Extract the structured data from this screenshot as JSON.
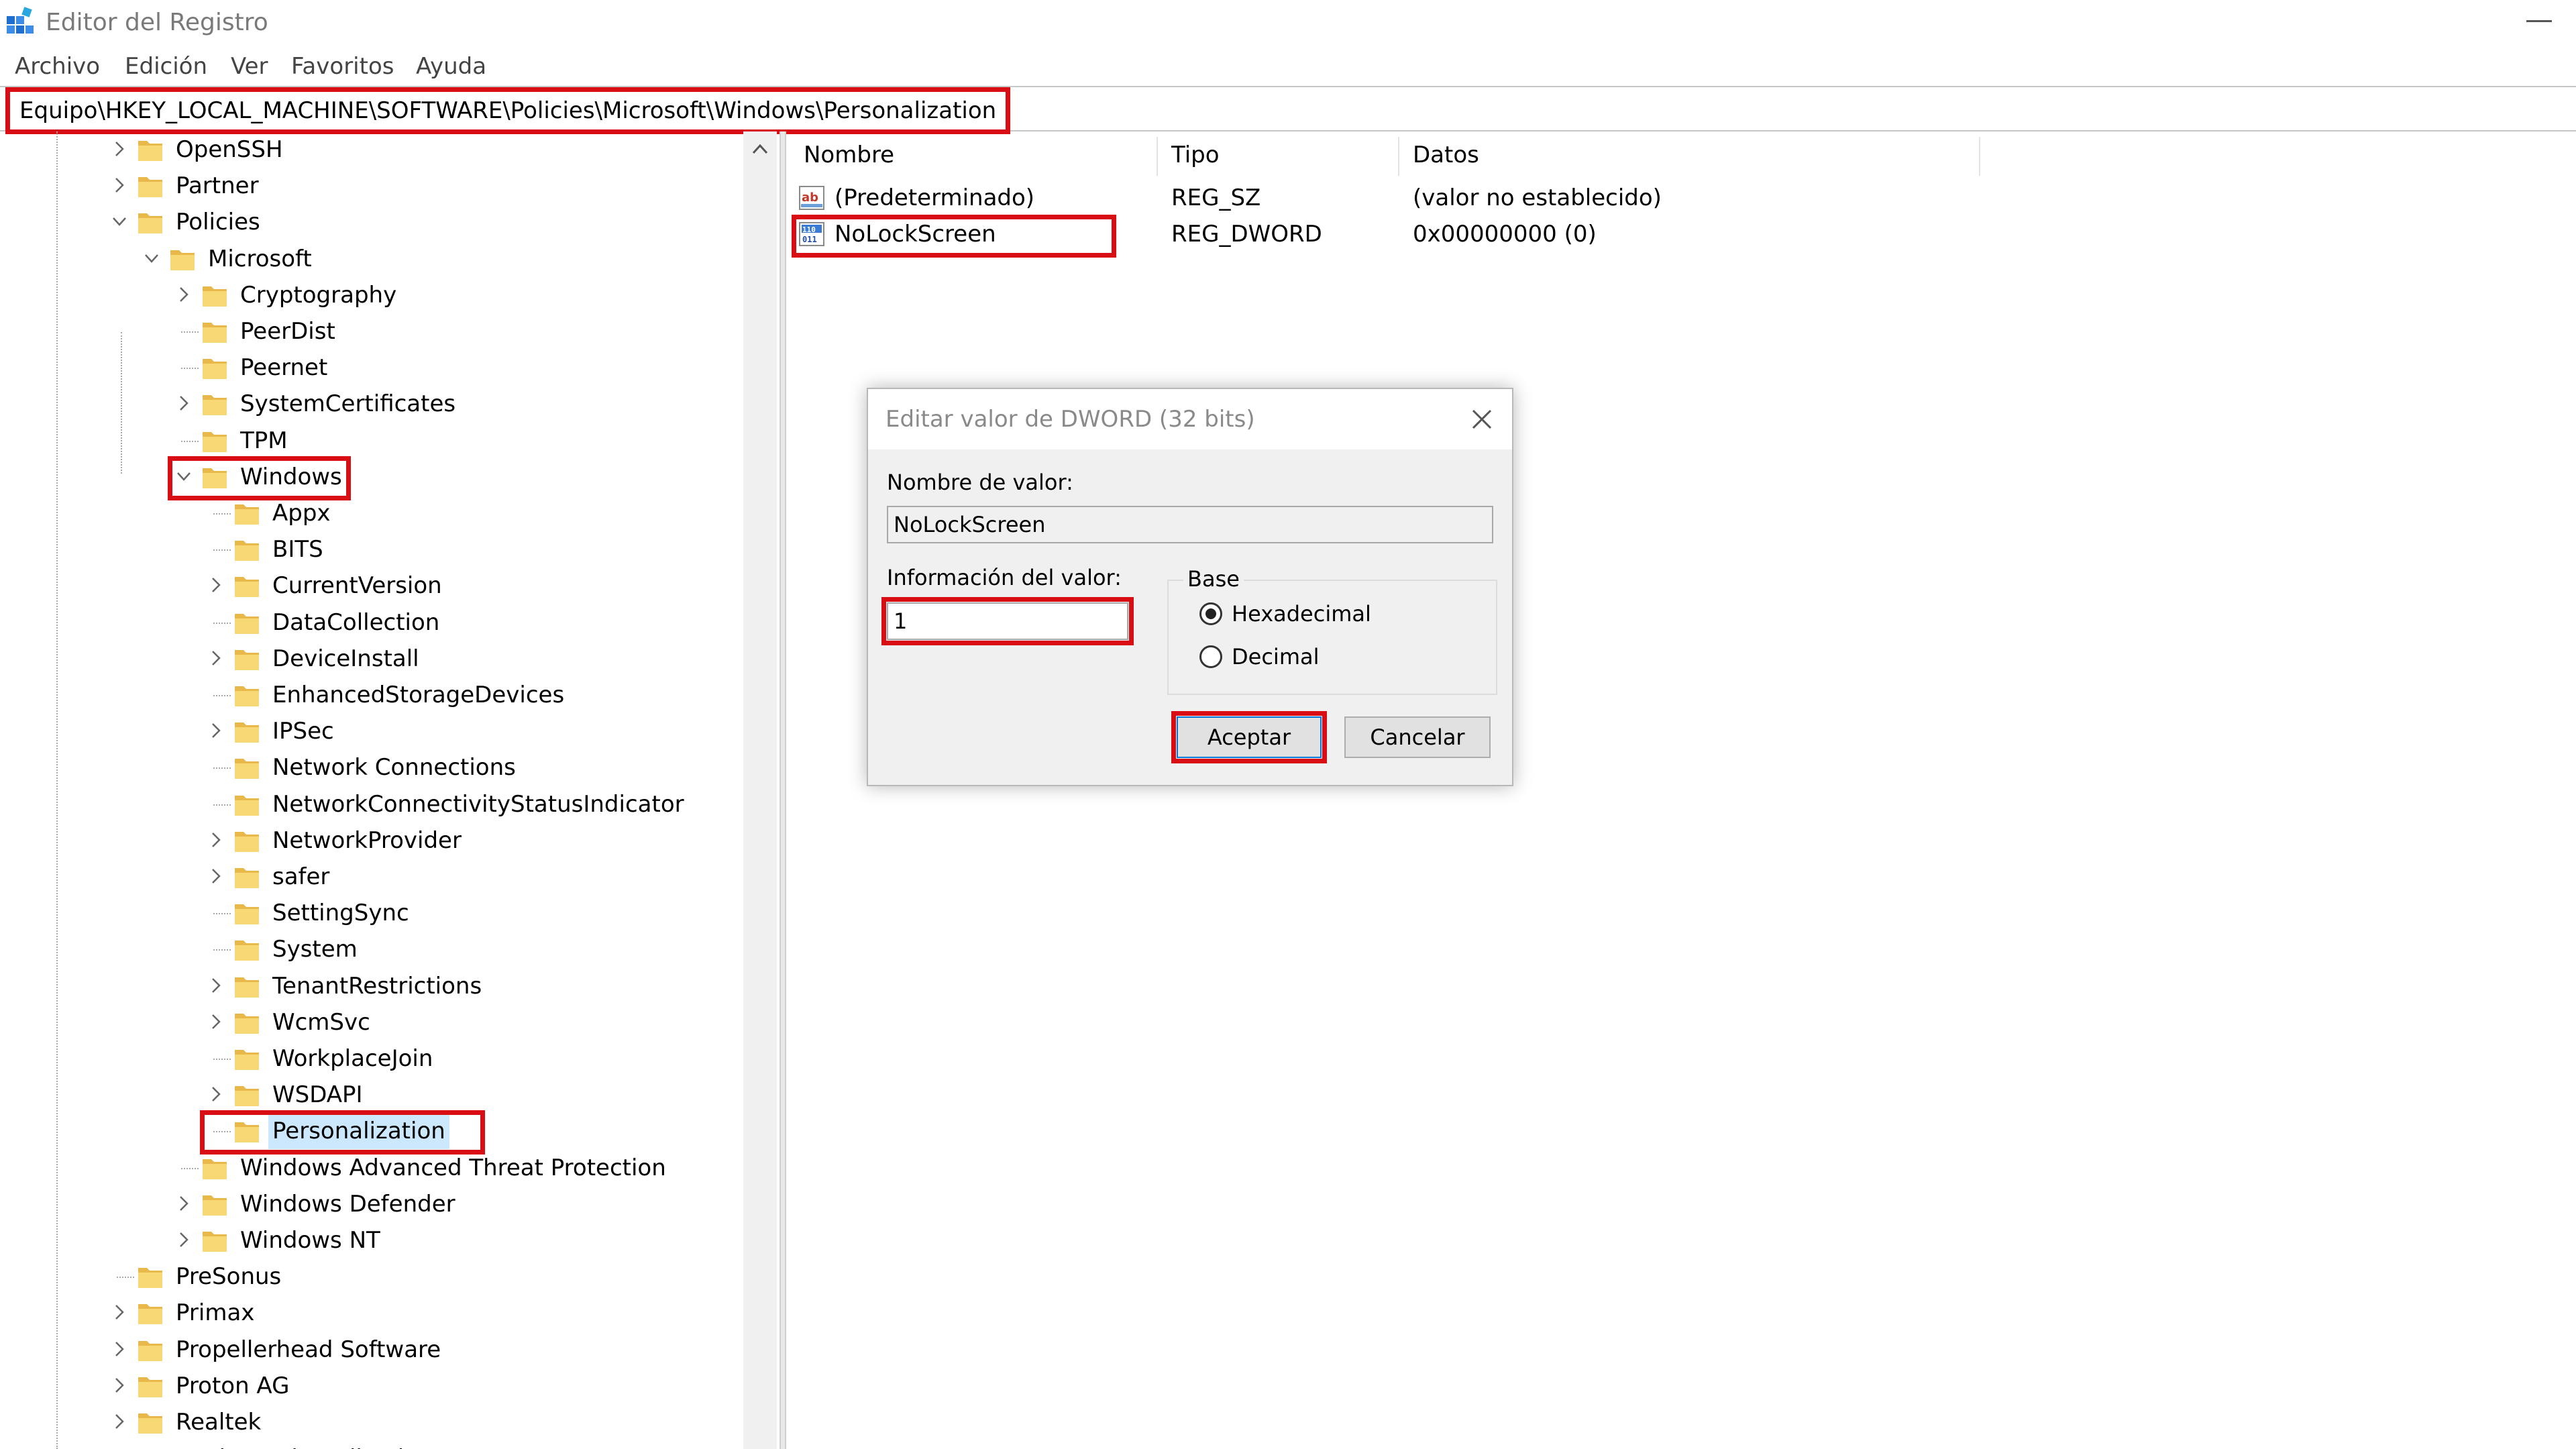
{
  "window": {
    "title": "Editor del Registro"
  },
  "menu": [
    "Archivo",
    "Edición",
    "Ver",
    "Favoritos",
    "Ayuda"
  ],
  "address": "Equipo\\HKEY_LOCAL_MACHINE\\SOFTWARE\\Policies\\Microsoft\\Windows\\Personalization",
  "tree": [
    {
      "label": "OpenSSH",
      "level": 0,
      "chevron": "right"
    },
    {
      "label": "Partner",
      "level": 0,
      "chevron": "right"
    },
    {
      "label": "Policies",
      "level": 0,
      "chevron": "down"
    },
    {
      "label": "Microsoft",
      "level": 1,
      "chevron": "down"
    },
    {
      "label": "Cryptography",
      "level": 2,
      "chevron": "right"
    },
    {
      "label": "PeerDist",
      "level": 2,
      "chevron": "none"
    },
    {
      "label": "Peernet",
      "level": 2,
      "chevron": "none"
    },
    {
      "label": "SystemCertificates",
      "level": 2,
      "chevron": "right"
    },
    {
      "label": "TPM",
      "level": 2,
      "chevron": "none"
    },
    {
      "label": "Windows",
      "level": 2,
      "chevron": "down",
      "highlight": true
    },
    {
      "label": "Appx",
      "level": 3,
      "chevron": "none"
    },
    {
      "label": "BITS",
      "level": 3,
      "chevron": "none"
    },
    {
      "label": "CurrentVersion",
      "level": 3,
      "chevron": "right"
    },
    {
      "label": "DataCollection",
      "level": 3,
      "chevron": "none"
    },
    {
      "label": "DeviceInstall",
      "level": 3,
      "chevron": "right"
    },
    {
      "label": "EnhancedStorageDevices",
      "level": 3,
      "chevron": "none"
    },
    {
      "label": "IPSec",
      "level": 3,
      "chevron": "right"
    },
    {
      "label": "Network Connections",
      "level": 3,
      "chevron": "none"
    },
    {
      "label": "NetworkConnectivityStatusIndicator",
      "level": 3,
      "chevron": "none"
    },
    {
      "label": "NetworkProvider",
      "level": 3,
      "chevron": "right"
    },
    {
      "label": "safer",
      "level": 3,
      "chevron": "right"
    },
    {
      "label": "SettingSync",
      "level": 3,
      "chevron": "none"
    },
    {
      "label": "System",
      "level": 3,
      "chevron": "none"
    },
    {
      "label": "TenantRestrictions",
      "level": 3,
      "chevron": "right"
    },
    {
      "label": "WcmSvc",
      "level": 3,
      "chevron": "right"
    },
    {
      "label": "WorkplaceJoin",
      "level": 3,
      "chevron": "none"
    },
    {
      "label": "WSDAPI",
      "level": 3,
      "chevron": "right"
    },
    {
      "label": "Personalization",
      "level": 3,
      "chevron": "none",
      "highlight": true,
      "selected": true
    },
    {
      "label": "Windows Advanced Threat Protection",
      "level": 2,
      "chevron": "none"
    },
    {
      "label": "Windows Defender",
      "level": 2,
      "chevron": "right"
    },
    {
      "label": "Windows NT",
      "level": 2,
      "chevron": "right"
    },
    {
      "label": "PreSonus",
      "level": 0,
      "chevron": "none"
    },
    {
      "label": "Primax",
      "level": 0,
      "chevron": "right"
    },
    {
      "label": "Propellerhead Software",
      "level": 0,
      "chevron": "right"
    },
    {
      "label": "Proton AG",
      "level": 0,
      "chevron": "right"
    },
    {
      "label": "Realtek",
      "level": 0,
      "chevron": "right"
    },
    {
      "label": "Registered Applications",
      "level": 0,
      "chevron": "none"
    }
  ],
  "list": {
    "columns": [
      "Nombre",
      "Tipo",
      "Datos"
    ],
    "rows": [
      {
        "name": "(Predeterminado)",
        "type": "REG_SZ",
        "data": "(valor no establecido)",
        "icon": "string-value-icon"
      },
      {
        "name": "NoLockScreen",
        "type": "REG_DWORD",
        "data": "0x00000000 (0)",
        "icon": "dword-value-icon",
        "highlight": true
      }
    ]
  },
  "dialog": {
    "title": "Editar valor de DWORD (32 bits)",
    "name_label": "Nombre de valor:",
    "name_value": "NoLockScreen",
    "data_label": "Información del valor:",
    "data_value": "1",
    "base_label": "Base",
    "radio_hex": "Hexadecimal",
    "radio_dec": "Decimal",
    "selected_base": "Hexadecimal",
    "ok_label": "Aceptar",
    "cancel_label": "Cancelar"
  },
  "colors": {
    "highlight": "#d90d14",
    "folder": "#f8d775",
    "selection": "#cce8ff"
  }
}
